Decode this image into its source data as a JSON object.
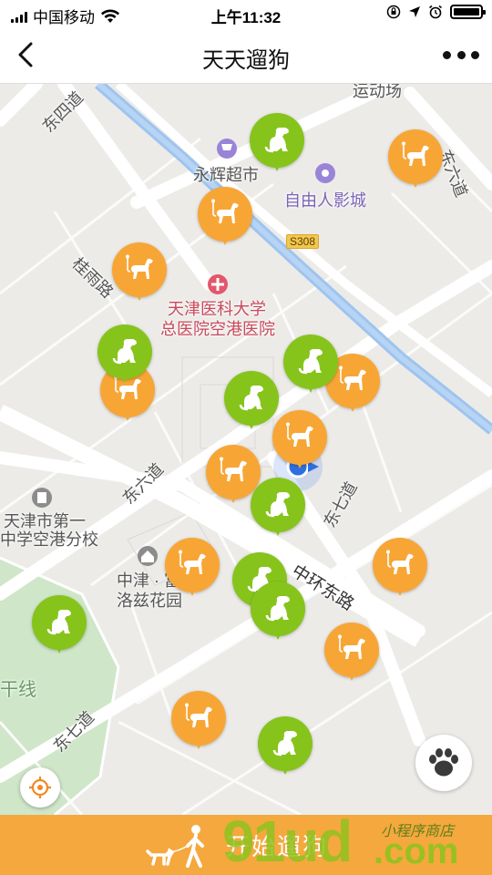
{
  "status_bar": {
    "carrier": "中国移动",
    "time": "上午11:32"
  },
  "nav": {
    "title": "天天遛狗",
    "back_icon": "chevron-left-icon",
    "more_icon": "more-dots-icon"
  },
  "map": {
    "labels": {
      "sports_field": "运动场",
      "dongsi_road": "东四道",
      "yonghui": "永辉超市",
      "freeman_cinema": "自由人影城",
      "dongliu_top": "东六道",
      "s308": "S308",
      "guiyu_road": "桂雨路",
      "hospital_line1": "天津医科大学",
      "hospital_line2": "总医院空港医院",
      "dongliu_road": "东六道",
      "dongqi_road_mid": "东七道",
      "school_line1": "天津市第一",
      "school_line2": "中学空港分校",
      "zhonghuan_road": "中环东路",
      "garden_line1": "中津 · 富",
      "garden_line2": "洛兹花园",
      "gan_line": "干线",
      "dongqi_road_bottom": "东七道"
    },
    "markers": {
      "color_orange": "#f7a636",
      "color_green": "#86c41c",
      "icon": "dog-walking-icon"
    }
  },
  "controls": {
    "locate_icon": "locate-target-icon",
    "paw_icon": "paw-icon"
  },
  "bottom": {
    "start_label": "开始遛狗",
    "icon": "person-walking-dog-icon",
    "bg_color": "#f5a83d"
  },
  "watermark": {
    "brand": "91ud",
    "tagline": "小程序商店",
    "domain": ".com"
  }
}
